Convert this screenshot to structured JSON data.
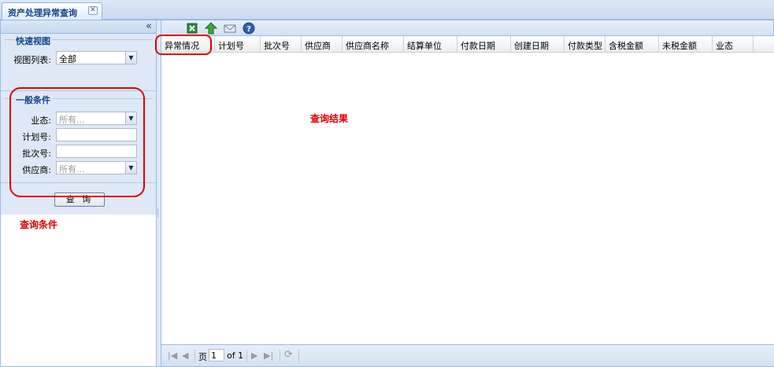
{
  "tab": {
    "title": "资产处理异常查询",
    "close_label": "✕"
  },
  "left_panel": {
    "collapse_label": "«",
    "quick_view": {
      "legend": "快速视图",
      "view_list_label": "视图列表:",
      "view_list_value": "全部"
    },
    "general_conditions": {
      "legend": "一般条件",
      "fields": [
        {
          "label": "业态:",
          "value": "所有...",
          "type": "select"
        },
        {
          "label": "计划号:",
          "value": "",
          "type": "text"
        },
        {
          "label": "批次号:",
          "value": "",
          "type": "text"
        },
        {
          "label": "供应商:",
          "value": "所有...",
          "type": "select"
        }
      ]
    },
    "query_button": "查 询",
    "annotation": "查询条件"
  },
  "toolbar": {
    "icons": [
      "excel-export-icon",
      "upload-arrow-icon",
      "mail-icon",
      "help-icon"
    ]
  },
  "grid": {
    "columns": [
      "异常情况",
      "计划号",
      "批次号",
      "供应商",
      "供应商名称",
      "结算单位",
      "付款日期",
      "创建日期",
      "付款类型",
      "含税金额",
      "未税金额",
      "业态"
    ],
    "rows": [],
    "annotation": "查询结果"
  },
  "pager": {
    "page_label": "页",
    "page_value": "1",
    "of_label": "of 1"
  },
  "colors": {
    "accent": "#15428b",
    "border": "#99bbe8",
    "annotation": "#e00000"
  }
}
